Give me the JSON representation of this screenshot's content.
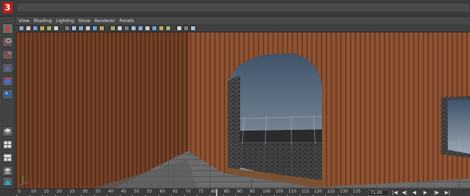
{
  "app": {
    "logo_letter": "3",
    "brand_color": "#c8191c"
  },
  "viewport_menu": [
    "View",
    "Shading",
    "Lighting",
    "Show",
    "Renderer",
    "Panels"
  ],
  "viewport_icons": [
    "camera-select-icon",
    "camera-attributes-icon",
    "bookmark-icon",
    "image-plane-icon",
    "2d-pan-icon",
    "grease-pencil-icon",
    "grid-icon",
    "film-gate-icon",
    "resolution-gate-icon",
    "gate-mask-icon",
    "field-chart-icon",
    "safe-action-icon",
    "wireframe-icon",
    "smooth-shade-icon",
    "default-material-icon",
    "textured-icon",
    "use-all-lights-icon",
    "shadows-icon",
    "screen-space-ao-icon",
    "motion-blur-icon",
    "anti-aliasing-icon",
    "isolate-select-icon",
    "xray-icon",
    "xray-joints-icon"
  ],
  "tools": [
    "select-tool-icon",
    "lasso-tool-icon",
    "paint-select-icon",
    "move-tool-icon",
    "rotate-tool-icon",
    "scale-tool-icon"
  ],
  "layout_tools": [
    "layers-icon",
    "four-view-layout-icon",
    "two-view-layout-icon",
    "outliner-layout-icon",
    "render-view-icon"
  ],
  "timeline": {
    "ticks": [
      "5",
      "10",
      "15",
      "20",
      "25",
      "30",
      "35",
      "40",
      "45",
      "50",
      "55",
      "60",
      "65",
      "70",
      "75",
      "80",
      "85",
      "90",
      "95",
      "100",
      "105",
      "110",
      "115",
      "120",
      "125",
      "130",
      "135"
    ],
    "current_frame": "71.00",
    "transport": [
      "go-to-start-icon",
      "step-back-icon",
      "play-back-icon",
      "play-forward-icon",
      "step-forward-icon",
      "go-to-end-icon"
    ]
  },
  "colors": {
    "wall": "#8a4f2f",
    "sky": "#5f7890",
    "floor": "#6b6b6b",
    "stone": "#3a3a3a"
  }
}
